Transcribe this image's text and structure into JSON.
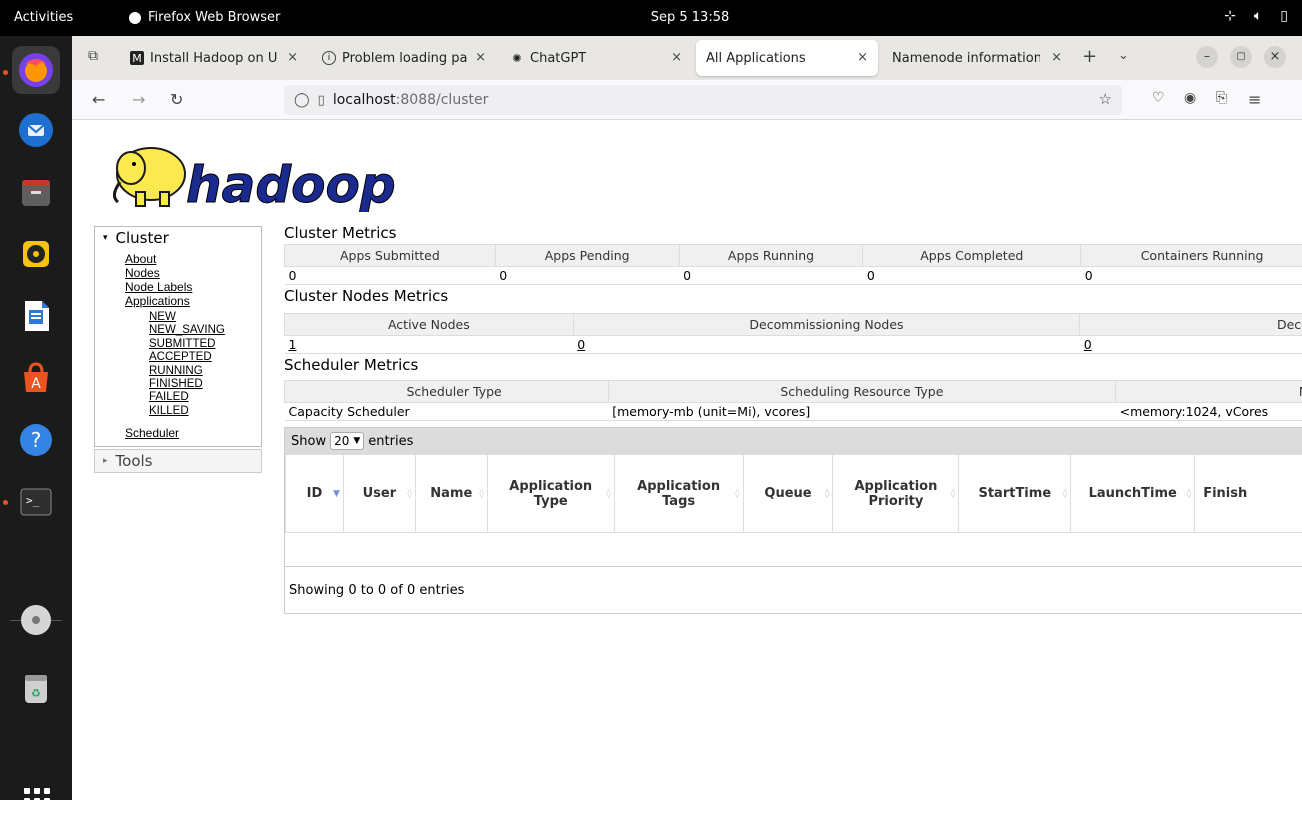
{
  "desktop": {
    "activities_label": "Activities",
    "app_name": "Firefox Web Browser",
    "clock": "Sep 5  13:58"
  },
  "browser": {
    "tabs": [
      {
        "label": "Install Hadoop on U",
        "icon": "medium-icon"
      },
      {
        "label": "Problem loading pa",
        "icon": "info-icon"
      },
      {
        "label": "ChatGPT",
        "icon": "chatgpt-icon"
      },
      {
        "label": "All Applications",
        "icon": "",
        "active": true
      },
      {
        "label": "Namenode information",
        "icon": ""
      }
    ],
    "url_host": "localhost",
    "url_path": ":8088/cluster"
  },
  "sidebar": {
    "cluster_label": "Cluster",
    "links": [
      "About",
      "Nodes",
      "Node Labels",
      "Applications"
    ],
    "app_states": [
      "NEW",
      "NEW_SAVING",
      "SUBMITTED",
      "ACCEPTED",
      "RUNNING",
      "FINISHED",
      "FAILED",
      "KILLED"
    ],
    "scheduler_label": "Scheduler",
    "tools_label": "Tools"
  },
  "cluster_metrics": {
    "title": "Cluster Metrics",
    "headers": [
      "Apps Submitted",
      "Apps Pending",
      "Apps Running",
      "Apps Completed",
      "Containers Running"
    ],
    "values": [
      "0",
      "0",
      "0",
      "0",
      "0"
    ]
  },
  "nodes_metrics": {
    "title": "Cluster Nodes Metrics",
    "headers": [
      "Active Nodes",
      "Decommissioning Nodes",
      "Decom"
    ],
    "values": [
      "1",
      "0",
      "0"
    ]
  },
  "scheduler_metrics": {
    "title": "Scheduler Metrics",
    "headers": [
      "Scheduler Type",
      "Scheduling Resource Type",
      "Min"
    ],
    "values": [
      "Capacity Scheduler",
      "[memory-mb (unit=Mi), vcores]",
      "<memory:1024, vCores"
    ]
  },
  "apps_table": {
    "show_label": "Show",
    "page_size": "20",
    "entries_label": "entries",
    "columns": [
      "ID",
      "User",
      "Name",
      "Application Type",
      "Application Tags",
      "Queue",
      "Application Priority",
      "StartTime",
      "LaunchTime",
      "Finish"
    ],
    "info": "Showing 0 to 0 of 0 entries"
  },
  "colors": {
    "hadoop_yellow": "#fce94f",
    "hadoop_blue": "#1a2a8f",
    "ubuntu_orange": "#e95420"
  }
}
